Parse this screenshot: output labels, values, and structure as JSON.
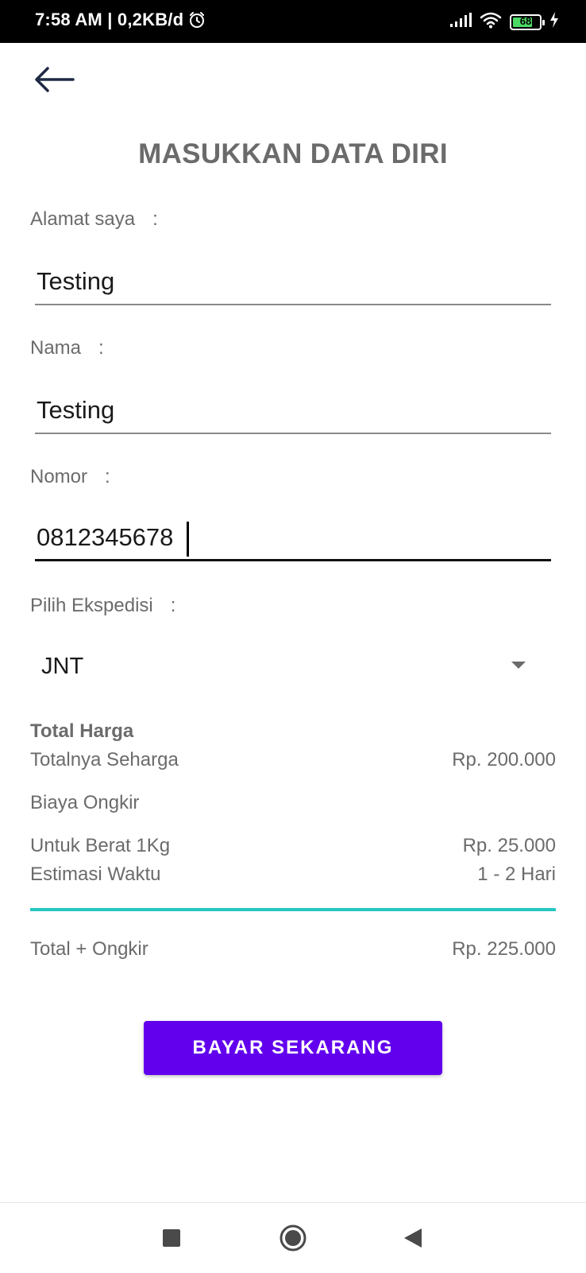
{
  "status_bar": {
    "time_info": "7:58 AM | 0,2KB/d",
    "battery_level": "68",
    "icons": [
      "alarm-icon",
      "signal-icon",
      "wifi-icon",
      "battery-icon",
      "charging-icon"
    ]
  },
  "header": {
    "back_icon": "arrow-left-icon",
    "title": "MASUKKAN DATA DIRI"
  },
  "form": {
    "address": {
      "label": "Alamat saya",
      "colon": ":",
      "value": "Testing"
    },
    "name": {
      "label": "Nama",
      "colon": ":",
      "value": "Testing"
    },
    "phone": {
      "label": "Nomor",
      "colon": ":",
      "value": "0812345678"
    },
    "expedition": {
      "label": "Pilih Ekspedisi",
      "colon": ":",
      "selected": "JNT"
    }
  },
  "summary": {
    "heading": "Total Harga",
    "subtotal": {
      "label": "Totalnya Seharga",
      "value": "Rp. 200.000"
    },
    "shipping_heading": "Biaya Ongkir",
    "weight": {
      "label": "Untuk Berat 1Kg",
      "value": "Rp. 25.000"
    },
    "estimate": {
      "label": "Estimasi Waktu",
      "value": "1 - 2 Hari"
    },
    "total": {
      "label": "Total + Ongkir",
      "value": "Rp. 225.000"
    }
  },
  "actions": {
    "pay_label": "BAYAR SEKARANG"
  },
  "colors": {
    "accent": "#6200ee",
    "divider": "#26c6c0",
    "label_text": "#6b6b6b"
  },
  "nav_bar": {
    "icons": [
      "recents-square-icon",
      "home-circle-icon",
      "back-triangle-icon"
    ]
  }
}
